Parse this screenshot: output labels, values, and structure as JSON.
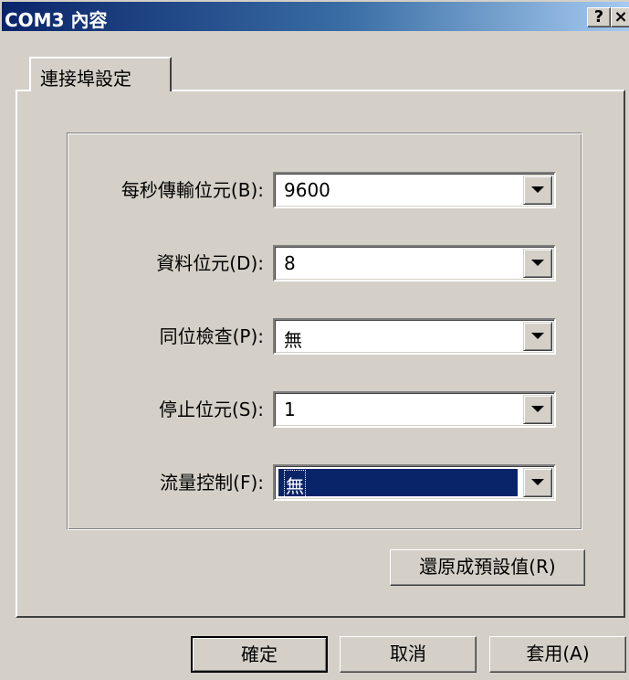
{
  "window": {
    "title": "COM3 內容",
    "help_label": "?",
    "close_label": "×"
  },
  "tabs": [
    {
      "label": "連接埠設定"
    }
  ],
  "fields": [
    {
      "label": "每秒傳輸位元(B):",
      "value": "9600"
    },
    {
      "label": "資料位元(D):",
      "value": "8"
    },
    {
      "label": "同位檢查(P):",
      "value": "無"
    },
    {
      "label": "停止位元(S):",
      "value": "1"
    },
    {
      "label": "流量控制(F):",
      "value": "無"
    }
  ],
  "buttons": {
    "restore_defaults": "還原成預設值(R)",
    "ok": "確定",
    "cancel": "取消",
    "apply": "套用(A)"
  },
  "colors": {
    "titlebar_start": "#0a246a",
    "titlebar_end": "#a6caf0",
    "face": "#d4d0c8",
    "selection": "#0a246a"
  }
}
